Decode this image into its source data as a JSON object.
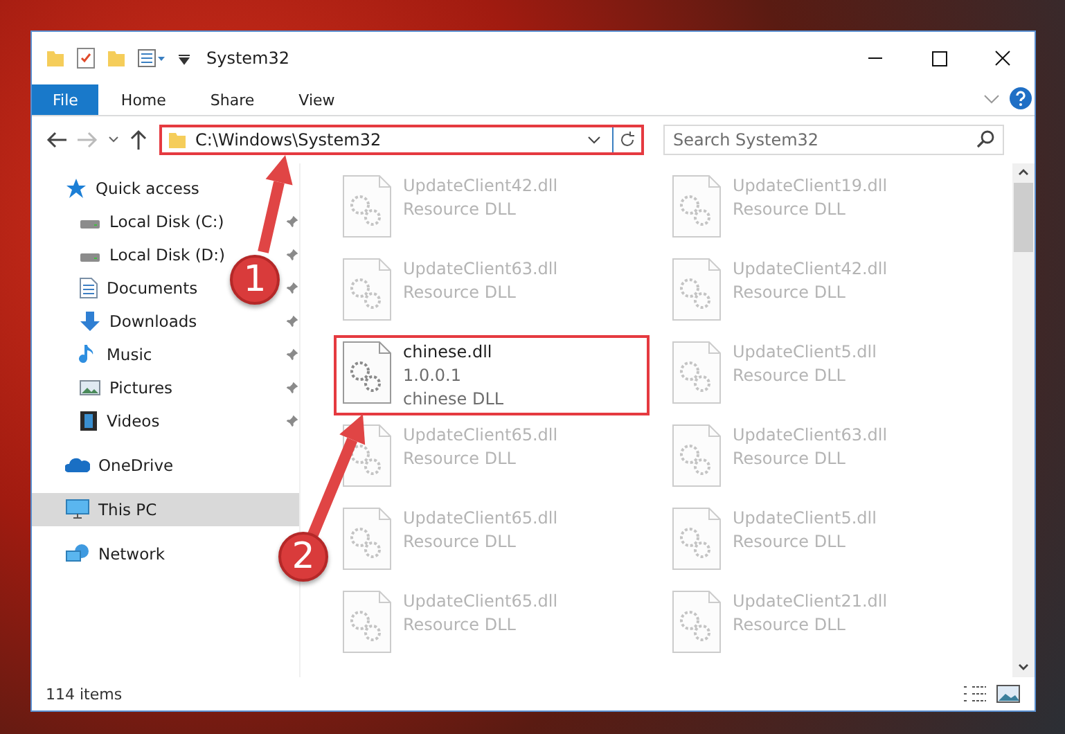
{
  "window": {
    "title": "System32"
  },
  "ribbon_tabs": [
    {
      "label": "File",
      "selected": true
    },
    {
      "label": "Home",
      "selected": false
    },
    {
      "label": "Share",
      "selected": false
    },
    {
      "label": "View",
      "selected": false
    }
  ],
  "address_bar": {
    "path": "C:\\Windows\\System32",
    "highlighted": true
  },
  "search": {
    "placeholder": "Search System32"
  },
  "nav_pane": [
    {
      "label": "Quick access",
      "kind": "star",
      "selected": false,
      "children": [
        {
          "label": "Local Disk (C:)",
          "kind": "drive",
          "pinned": true,
          "selected": false
        },
        {
          "label": "Local Disk (D:)",
          "kind": "drive",
          "pinned": true,
          "selected": false
        },
        {
          "label": "Documents",
          "kind": "documents",
          "pinned": true,
          "selected": false
        },
        {
          "label": "Downloads",
          "kind": "downloads",
          "pinned": true,
          "selected": false
        },
        {
          "label": "Music",
          "kind": "music",
          "pinned": true,
          "selected": false
        },
        {
          "label": "Pictures",
          "kind": "pictures",
          "pinned": true,
          "selected": false
        },
        {
          "label": "Videos",
          "kind": "videos",
          "pinned": true,
          "selected": false
        }
      ]
    },
    {
      "label": "OneDrive",
      "kind": "cloud",
      "selected": false
    },
    {
      "label": "This PC",
      "kind": "computer",
      "selected": true
    },
    {
      "label": "Network",
      "kind": "network",
      "selected": false
    }
  ],
  "files": [
    {
      "name": "UpdateClient42.dll",
      "details": [
        "Resource DLL"
      ],
      "blurred": true,
      "highlighted": false
    },
    {
      "name": "UpdateClient19.dll",
      "details": [
        "Resource DLL"
      ],
      "blurred": true,
      "highlighted": false
    },
    {
      "name": "UpdateClient63.dll",
      "details": [
        "Resource DLL"
      ],
      "blurred": true,
      "highlighted": false
    },
    {
      "name": "UpdateClient42.dll",
      "details": [
        "Resource DLL"
      ],
      "blurred": true,
      "highlighted": false
    },
    {
      "name": "chinese.dll",
      "details": [
        "1.0.0.1",
        "chinese DLL"
      ],
      "blurred": false,
      "highlighted": true
    },
    {
      "name": "UpdateClient5.dll",
      "details": [
        "Resource DLL"
      ],
      "blurred": true,
      "highlighted": false
    },
    {
      "name": "UpdateClient65.dll",
      "details": [
        "Resource DLL"
      ],
      "blurred": true,
      "highlighted": false
    },
    {
      "name": "UpdateClient63.dll",
      "details": [
        "Resource DLL"
      ],
      "blurred": true,
      "highlighted": false
    },
    {
      "name": "UpdateClient65.dll",
      "details": [
        "Resource DLL"
      ],
      "blurred": true,
      "highlighted": false
    },
    {
      "name": "UpdateClient5.dll",
      "details": [
        "Resource DLL"
      ],
      "blurred": true,
      "highlighted": false
    },
    {
      "name": "UpdateClient65.dll",
      "details": [
        "Resource DLL"
      ],
      "blurred": true,
      "highlighted": false
    },
    {
      "name": "UpdateClient21.dll",
      "details": [
        "Resource DLL"
      ],
      "blurred": true,
      "highlighted": false
    }
  ],
  "status_bar": {
    "item_count": "114 items"
  },
  "annotations": [
    {
      "number": "1"
    },
    {
      "number": "2"
    }
  ]
}
